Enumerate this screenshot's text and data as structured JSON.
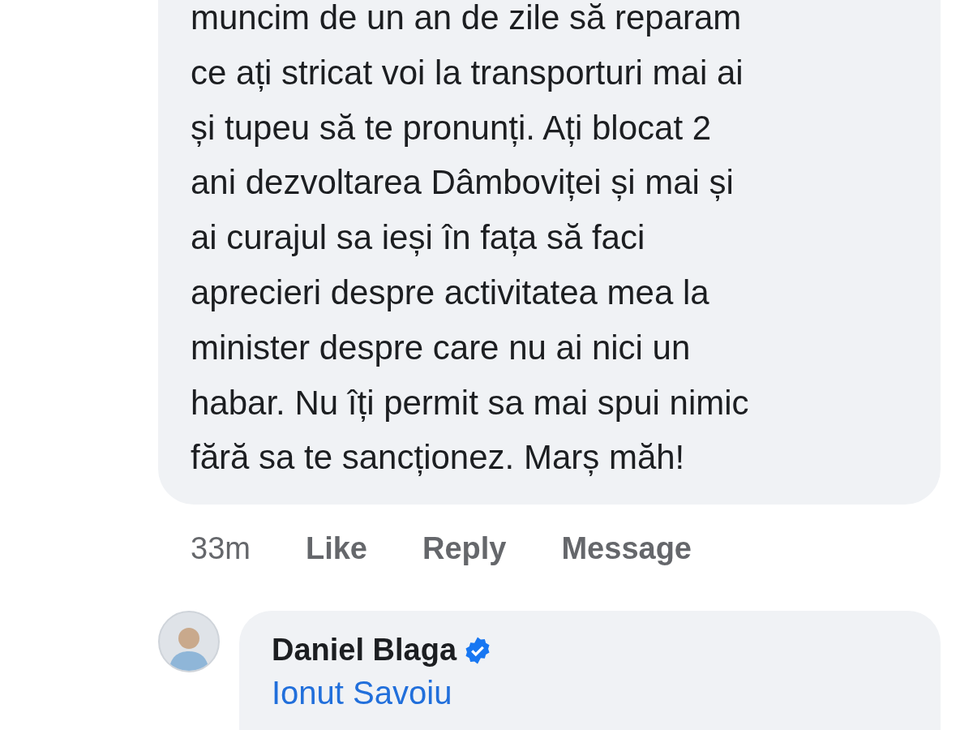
{
  "comment": {
    "lines": [
      "muncim de un an de zile să reparam",
      "ce ați stricat voi la transporturi mai ai",
      "și tupeu să te pronunți. Ați blocat 2",
      "ani dezvoltarea Dâmboviței și mai și",
      "ai curajul sa ieși în fața să faci",
      "aprecieri despre activitatea mea la",
      "minister despre care nu ai nici un",
      "habar. Nu îți permit sa mai spui nimic",
      "fără sa te sancționez. Marș măh!"
    ]
  },
  "actions": {
    "time": "33m",
    "buttons": [
      "Like",
      "Reply",
      "Message"
    ]
  },
  "reply": {
    "author": "Daniel Blaga",
    "verified": true,
    "mention": "Ionut Savoiu"
  }
}
